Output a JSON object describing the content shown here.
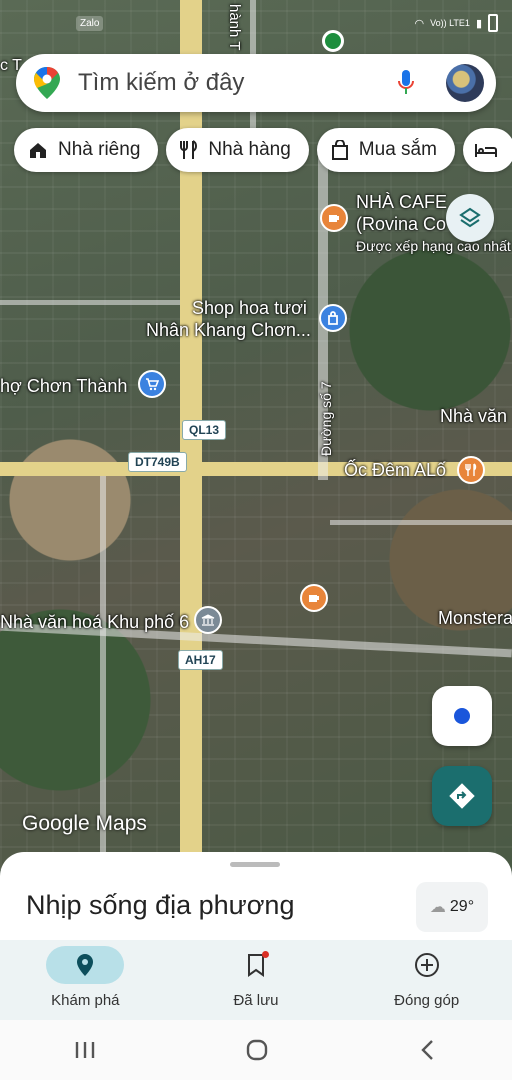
{
  "status_bar": {
    "app_badge": "Zalo",
    "network": "Vo)) LTE1"
  },
  "search": {
    "placeholder": "Tìm kiếm ở đây"
  },
  "chips": [
    {
      "label": "Nhà riêng",
      "icon": "home-icon"
    },
    {
      "label": "Nhà hàng",
      "icon": "restaurant-icon"
    },
    {
      "label": "Mua sắm",
      "icon": "shopping-bag-icon"
    },
    {
      "label": "",
      "icon": "hotel-icon"
    }
  ],
  "map": {
    "labels": {
      "nha_cafe_1": "NHÀ CAFE",
      "nha_cafe_2": "(Rovina Co",
      "nha_cafe_3": "Được xếp hạng cao nhất",
      "shop_hoa_1": "Shop hoa tươi",
      "shop_hoa_2": "Nhân Khang Chơn...",
      "cho": "hợ Chơn Thành",
      "nha_van_top": "Nhà văn",
      "duong_so_7": "Đường số 7",
      "oc_dem": "Ốc Đêm ALố",
      "nha_van_hoa": "Nhà văn hoá Khu phố 6",
      "monstera": "Monstera",
      "street_top": "hành T",
      "top_left": "c T"
    },
    "shields": {
      "ql13": "QL13",
      "dt749b": "DT749B",
      "ah17": "AH17"
    },
    "watermark": "Google Maps"
  },
  "sheet": {
    "title": "Nhịp sống địa phương",
    "temperature": "29°"
  },
  "bottom_nav": [
    {
      "label": "Khám phá",
      "icon": "explore-pin-icon",
      "active": true
    },
    {
      "label": "Đã lưu",
      "icon": "bookmark-icon",
      "active": false
    },
    {
      "label": "Đóng góp",
      "icon": "add-circle-icon",
      "active": false
    }
  ],
  "colors": {
    "accent": "#1b6e6e",
    "active_pill": "#b8e0e8",
    "poi_food": "#e8853a",
    "poi_shop": "#3b82e0"
  }
}
